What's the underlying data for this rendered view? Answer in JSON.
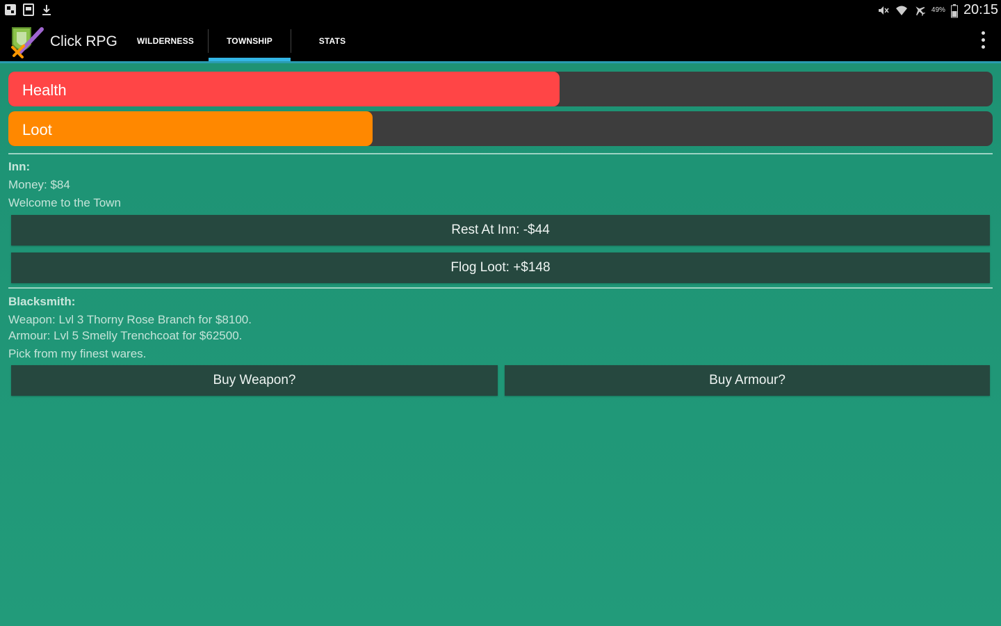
{
  "status_bar": {
    "left_icons": [
      "notification-square-icon",
      "sim-card-icon",
      "download-icon"
    ],
    "right_icons": [
      "mute-icon",
      "wifi-icon",
      "airplane-icon",
      "battery-icon"
    ],
    "battery_percent": "49%",
    "time": "20:15"
  },
  "app": {
    "title": "Click RPG",
    "tabs": [
      {
        "label": "WILDERNESS",
        "active": false
      },
      {
        "label": "TOWNSHIP",
        "active": true
      },
      {
        "label": "STATS",
        "active": false
      }
    ],
    "overflow_icon": "overflow-menu-icon"
  },
  "bars": {
    "health": {
      "label": "Health",
      "fraction": 0.56,
      "color": "#ff4546"
    },
    "loot": {
      "label": "Loot",
      "fraction": 0.37,
      "color": "#ff8800"
    }
  },
  "inn": {
    "heading": "Inn:",
    "money": "Money: $84",
    "message": "Welcome to the Town",
    "rest_button": "Rest At Inn: -$44",
    "flog_button": "Flog Loot: +$148"
  },
  "blacksmith": {
    "heading": "Blacksmith:",
    "weapon": "Weapon: Lvl 3 Thorny Rose Branch for $8100.",
    "armour": "Armour: Lvl 5 Smelly Trenchcoat for $62500.",
    "message": "Pick from my finest wares.",
    "buy_weapon_button": "Buy Weapon?",
    "buy_armour_button": "Buy Armour?"
  }
}
